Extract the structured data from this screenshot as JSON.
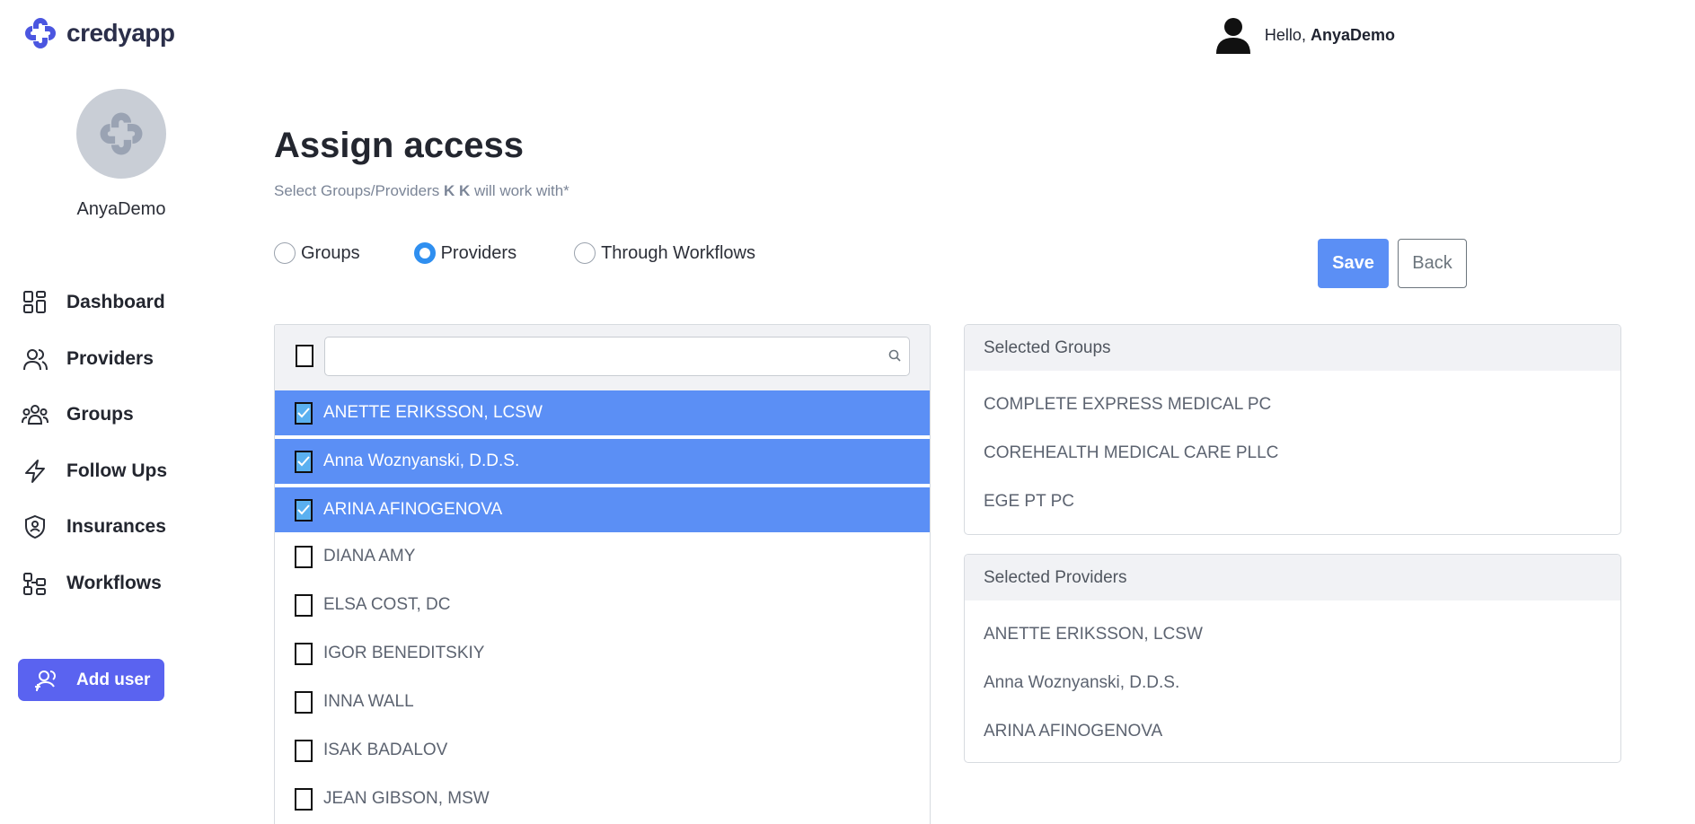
{
  "app": {
    "name": "credyapp"
  },
  "header": {
    "greeting": "Hello,",
    "username": "AnyaDemo"
  },
  "sidebar": {
    "profile_name": "AnyaDemo",
    "items": [
      {
        "label": "Dashboard",
        "icon": "dashboard-icon"
      },
      {
        "label": "Providers",
        "icon": "providers-icon"
      },
      {
        "label": "Groups",
        "icon": "groups-icon"
      },
      {
        "label": "Follow Ups",
        "icon": "lightning-icon"
      },
      {
        "label": "Insurances",
        "icon": "shield-icon"
      },
      {
        "label": "Workflows",
        "icon": "workflows-icon"
      }
    ],
    "add_user_label": "Add user"
  },
  "main": {
    "title": "Assign access",
    "subtitle_prefix": "Select Groups/Providers",
    "subtitle_user": "K K",
    "subtitle_suffix": "will work with*",
    "radios": [
      {
        "label": "Groups",
        "checked": false
      },
      {
        "label": "Providers",
        "checked": true
      },
      {
        "label": "Through Workflows",
        "checked": false
      }
    ],
    "save_label": "Save",
    "back_label": "Back",
    "search": {
      "placeholder": "",
      "value": ""
    },
    "providers": [
      {
        "name": "ANETTE ERIKSSON, LCSW",
        "checked": true
      },
      {
        "name": "Anna Woznyanski, D.D.S.",
        "checked": true
      },
      {
        "name": "ARINA AFINOGENOVA",
        "checked": true
      },
      {
        "name": "DIANA AMY",
        "checked": false
      },
      {
        "name": "ELSA COST, DC",
        "checked": false
      },
      {
        "name": "IGOR BENEDITSKIY",
        "checked": false
      },
      {
        "name": "INNA WALL",
        "checked": false
      },
      {
        "name": "ISAK BADALOV",
        "checked": false
      },
      {
        "name": "JEAN GIBSON, MSW",
        "checked": false
      }
    ]
  },
  "selected_groups": {
    "title": "Selected Groups",
    "items": [
      "COMPLETE EXPRESS MEDICAL PC",
      "COREHEALTH MEDICAL CARE PLLC",
      "EGE PT PC"
    ]
  },
  "selected_providers": {
    "title": "Selected Providers",
    "items": [
      "ANETTE ERIKSSON, LCSW",
      "Anna Woznyanski, D.D.S.",
      "ARINA AFINOGENOVA"
    ]
  },
  "colors": {
    "accent": "#5b8ff5",
    "add_user": "#5a63f0",
    "radio_checked": "#2f8ff0",
    "panel_header": "#f1f2f5"
  }
}
